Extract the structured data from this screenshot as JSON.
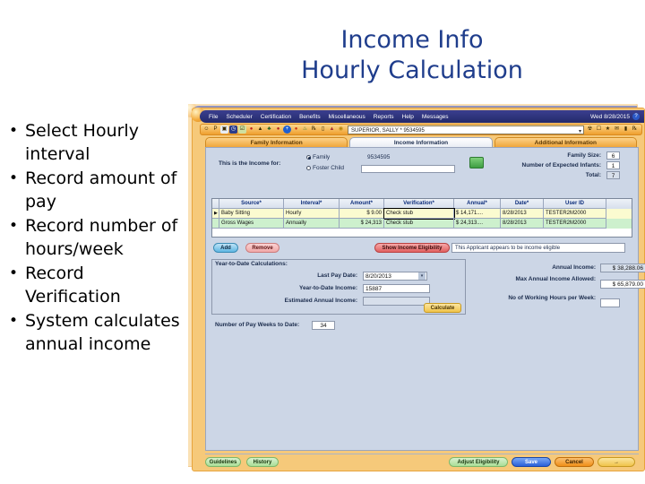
{
  "slide": {
    "title_line1": "Income Info",
    "title_line2": "Hourly Calculation",
    "title_color": "#1F3D8C",
    "bullets": [
      "Select Hourly interval",
      "Record amount of pay",
      "Record number of hours/week",
      "Record Verification",
      "System calculates annual income"
    ]
  },
  "app": {
    "menubar": {
      "items": [
        "File",
        "Scheduler",
        "Certification",
        "Benefits",
        "Miscellaneous",
        "Reports",
        "Help",
        "Messages"
      ],
      "date": "Wed 8/28/2015",
      "help_glyph": "?",
      "bg_color": "#2a3075"
    },
    "toolbar": {
      "icons": [
        "binoculars-icon",
        "person-icon",
        "calendar-icon",
        "clock-icon",
        "checklist-icon",
        "family-icon",
        "child-icon",
        "food-icon",
        "apple-icon",
        "plus-circle-icon",
        "tomato-icon",
        "plant-icon",
        "prescription-icon",
        "card-icon",
        "alert-icon",
        "refresh-icon"
      ],
      "client_select_value": "SUPERIOR, SALLY * 9534595",
      "right_icons": [
        "bulb-icon",
        "folder-icon",
        "star-icon",
        "mail-icon",
        "note-icon",
        "rx-icon"
      ],
      "bg_color": "#ef9f2e"
    },
    "tabs": [
      {
        "label": "Family Information",
        "active": false
      },
      {
        "label": "Income Information",
        "active": true
      },
      {
        "label": "Additional Information",
        "active": false
      }
    ],
    "income_for": {
      "label": "This is the Income for:",
      "options": [
        {
          "label": "Family",
          "selected": true
        },
        {
          "label": "Foster Child",
          "selected": false
        }
      ],
      "family_id": "9534595",
      "foster_child_value": "",
      "lookup_icon": "grid-lookup-icon"
    },
    "family_counts": [
      {
        "label": "Family Size:",
        "value": "6",
        "readonly": false
      },
      {
        "label": "Number of Expected Infants:",
        "value": "1",
        "readonly": false
      },
      {
        "label": "Total:",
        "value": "7",
        "readonly": true
      }
    ],
    "grid": {
      "headers": [
        "Source*",
        "Interval*",
        "Amount*",
        "Verification*",
        "Annual*",
        "Date*",
        "User ID"
      ],
      "rows": [
        {
          "selected": true,
          "source": "Baby Sitting",
          "interval": "Hourly",
          "amount": "$ 9.00",
          "verification": "Check stub",
          "annual": "$ 14,171....",
          "date": "8/28/2013",
          "user_id": "TESTER2M2000"
        },
        {
          "selected": false,
          "source": "Gross Wages",
          "interval": "Annually",
          "amount": "$ 24,313",
          "verification": "Check stub",
          "annual": "$ 24,313....",
          "date": "8/28/2013",
          "user_id": "TESTER2M2000"
        }
      ]
    },
    "grid_actions": {
      "add_label": "Add",
      "remove_label": "Remove",
      "show_eligibility_label": "Show Income Eligibility",
      "eligibility_text": "This Applicant appears to be income eligible"
    },
    "ytd_panel": {
      "title": "Year-to-Date Calculations:",
      "fields": [
        {
          "label": "Last Pay Date:",
          "value": "8/20/2013",
          "type": "combo"
        },
        {
          "label": "Year-to-Date Income:",
          "value": "15887",
          "type": "text"
        },
        {
          "label": "Estimated Annual Income:",
          "value": "",
          "type": "readonly"
        }
      ],
      "calculate_label": "Calculate"
    },
    "income_summary": [
      {
        "label": "Annual Income:",
        "value": "$ 38,288.06",
        "readonly": true
      },
      {
        "label": "Max Annual Income Allowed:",
        "value": "$ 65,879.00",
        "readonly": false
      },
      {
        "label": "No of Working Hours per Week:",
        "value": "",
        "readonly": false
      }
    ],
    "pay_weeks": {
      "label": "Number of Pay Weeks to Date:",
      "value": "34"
    },
    "footer": {
      "left_buttons": [
        "Guidelines",
        "History"
      ],
      "right_buttons": [
        {
          "label": "Adjust Eligibility",
          "style": "green"
        },
        {
          "label": "Save",
          "style": "navy"
        },
        {
          "label": "Cancel",
          "style": "orange"
        },
        {
          "label": "→",
          "style": "gold"
        }
      ]
    }
  }
}
